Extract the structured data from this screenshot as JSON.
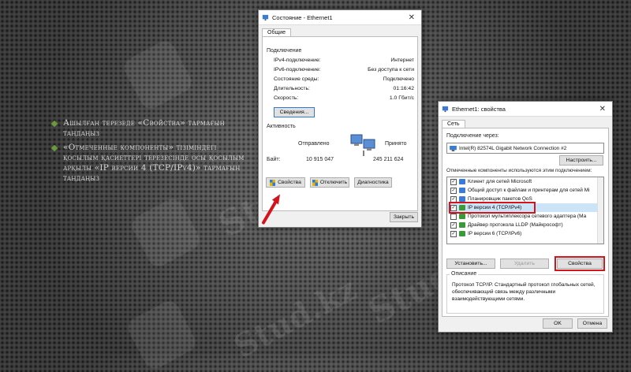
{
  "slide": {
    "bullets": [
      "Ашылған терезеде «Свойства» тармағын таңдаңыз",
      "«Отмеченные компоненты» тізіміндегі қосылым қасиеттері терезесінде осы қосылым арқылы «IP версии 4 (TCP/IPv4)» тармағын таңдаңыз"
    ],
    "watermark": "Stud.kz",
    "accent_color": "#6a9a3a"
  },
  "status_dialog": {
    "title": "Состояние - Ethernet1",
    "tab": "Общие",
    "connection_label": "Подключение",
    "rows": [
      {
        "k": "IPv4-подключение:",
        "v": "Интернет"
      },
      {
        "k": "IPv6-подключение:",
        "v": "Без доступа к сети"
      },
      {
        "k": "Состояние среды:",
        "v": "Подключено"
      },
      {
        "k": "Длительность:",
        "v": "01:16:42"
      },
      {
        "k": "Скорость:",
        "v": "1.0 Гбит/с"
      }
    ],
    "details_button": "Сведения...",
    "activity_label": "Активность",
    "sent_label": "Отправлено",
    "received_label": "Принято",
    "bytes_label": "Байт:",
    "bytes_sent": "10 915 047",
    "bytes_received": "245 211 624",
    "properties_button": "Свойства",
    "disable_button": "Отключить",
    "diagnose_button": "Диагностика",
    "close_button": "Закрыть"
  },
  "props_dialog": {
    "title": "Ethernet1: свойства",
    "tab": "Сеть",
    "connect_via_label": "Подключение через:",
    "adapter_name": "Intel(R) 82574L Gigabit Network Connection #2",
    "configure_button": "Настроить...",
    "components_label": "Отмеченные компоненты используются этим подключением:",
    "components": [
      {
        "label": "Клиент для сетей Microsoft",
        "checked": true,
        "icon_color": "#3a7bd5"
      },
      {
        "label": "Общий доступ к файлам и принтерам для сетей Mi",
        "checked": true,
        "icon_color": "#3a7bd5"
      },
      {
        "label": "Планировщик пакетов QoS",
        "checked": true,
        "icon_color": "#3a7bd5"
      },
      {
        "label": "IP версии 4 (TCP/IPv4)",
        "checked": true,
        "icon_color": "#3a9a3a"
      },
      {
        "label": "Протокол мультиплексора сетевого адаптера (Ма",
        "checked": false,
        "icon_color": "#3a9a3a"
      },
      {
        "label": "Драйвер протокола LLDP (Майкрософт)",
        "checked": true,
        "icon_color": "#3a9a3a"
      },
      {
        "label": "IP версии 6 (TCP/IPv6)",
        "checked": true,
        "icon_color": "#3a9a3a"
      }
    ],
    "install_button": "Установить...",
    "remove_button": "Удалить",
    "properties_button": "Свойства",
    "description_label": "Описание",
    "description_text": "Протокол TCP/IP. Стандартный протокол глобальных сетей, обеспечивающий связь между различными взаимодействующими сетями.",
    "ok_button": "OK",
    "cancel_button": "Отмена"
  },
  "colors": {
    "highlight": "#d4141b",
    "arrow": "#d4141b",
    "selection": "#cce4f7"
  }
}
